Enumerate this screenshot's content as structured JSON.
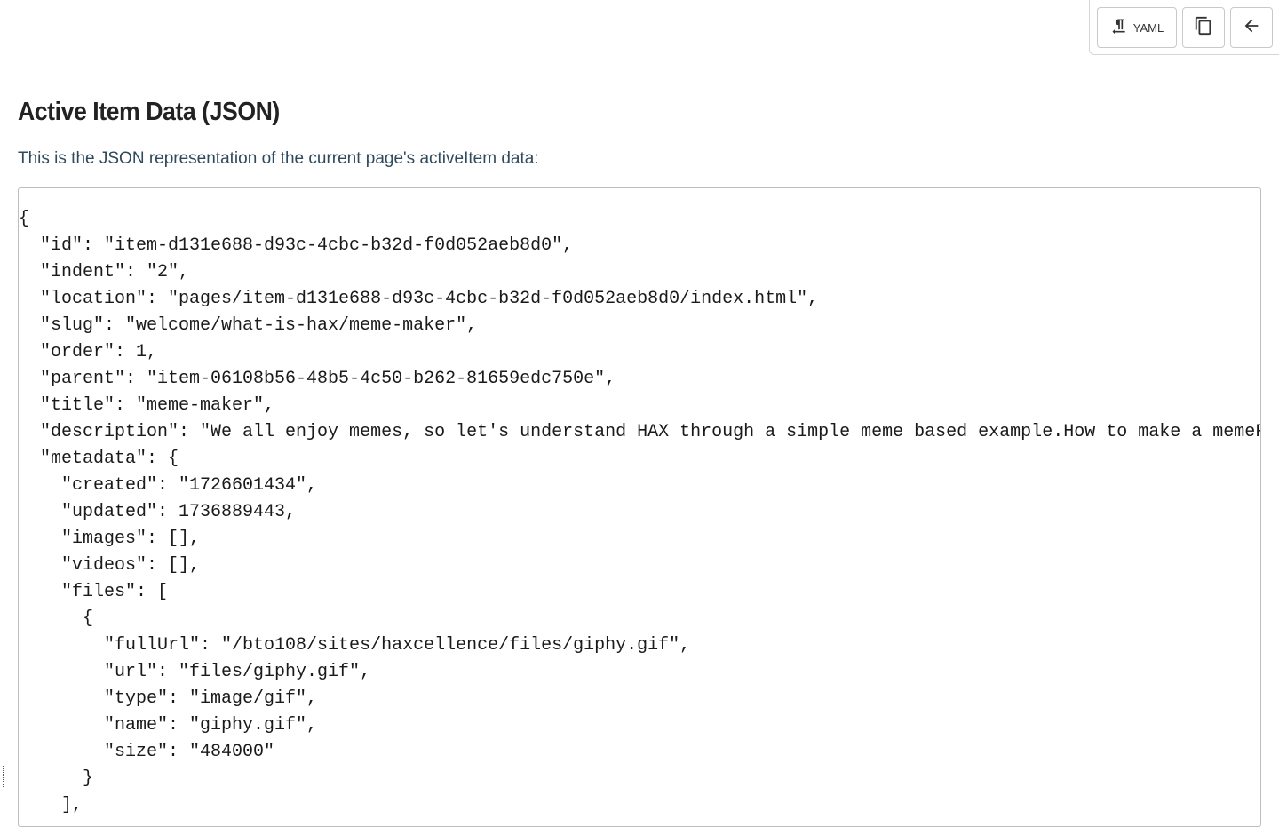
{
  "toolbar": {
    "yaml_label": "YAML",
    "yaml_icon": "format-paragraph-icon",
    "copy_icon": "copy-icon",
    "back_icon": "arrow-back-icon"
  },
  "heading": "Active Item Data (JSON)",
  "intro": "This is the JSON representation of the current page's activeItem data:",
  "code_lines": [
    "{",
    "  \"id\": \"item-d131e688-d93c-4cbc-b32d-f0d052aeb8d0\",",
    "  \"indent\": \"2\",",
    "  \"location\": \"pages/item-d131e688-d93c-4cbc-b32d-f0d052aeb8d0/index.html\",",
    "  \"slug\": \"welcome/what-is-hax/meme-maker\",",
    "  \"order\": 1,",
    "  \"parent\": \"item-06108b56-48b5-4c50-b262-81659edc750e\",",
    "  \"title\": \"meme-maker\",",
    "  \"description\": \"We all enjoy memes, so let's understand HAX through a simple meme based example.How to make a memeFi",
    "  \"metadata\": {",
    "    \"created\": \"1726601434\",",
    "    \"updated\": 1736889443,",
    "    \"images\": [],",
    "    \"videos\": [],",
    "    \"files\": [",
    "      {",
    "        \"fullUrl\": \"/bto108/sites/haxcellence/files/giphy.gif\",",
    "        \"url\": \"files/giphy.gif\",",
    "        \"type\": \"image/gif\",",
    "        \"name\": \"giphy.gif\",",
    "        \"size\": \"484000\"",
    "      }",
    "    ],"
  ]
}
